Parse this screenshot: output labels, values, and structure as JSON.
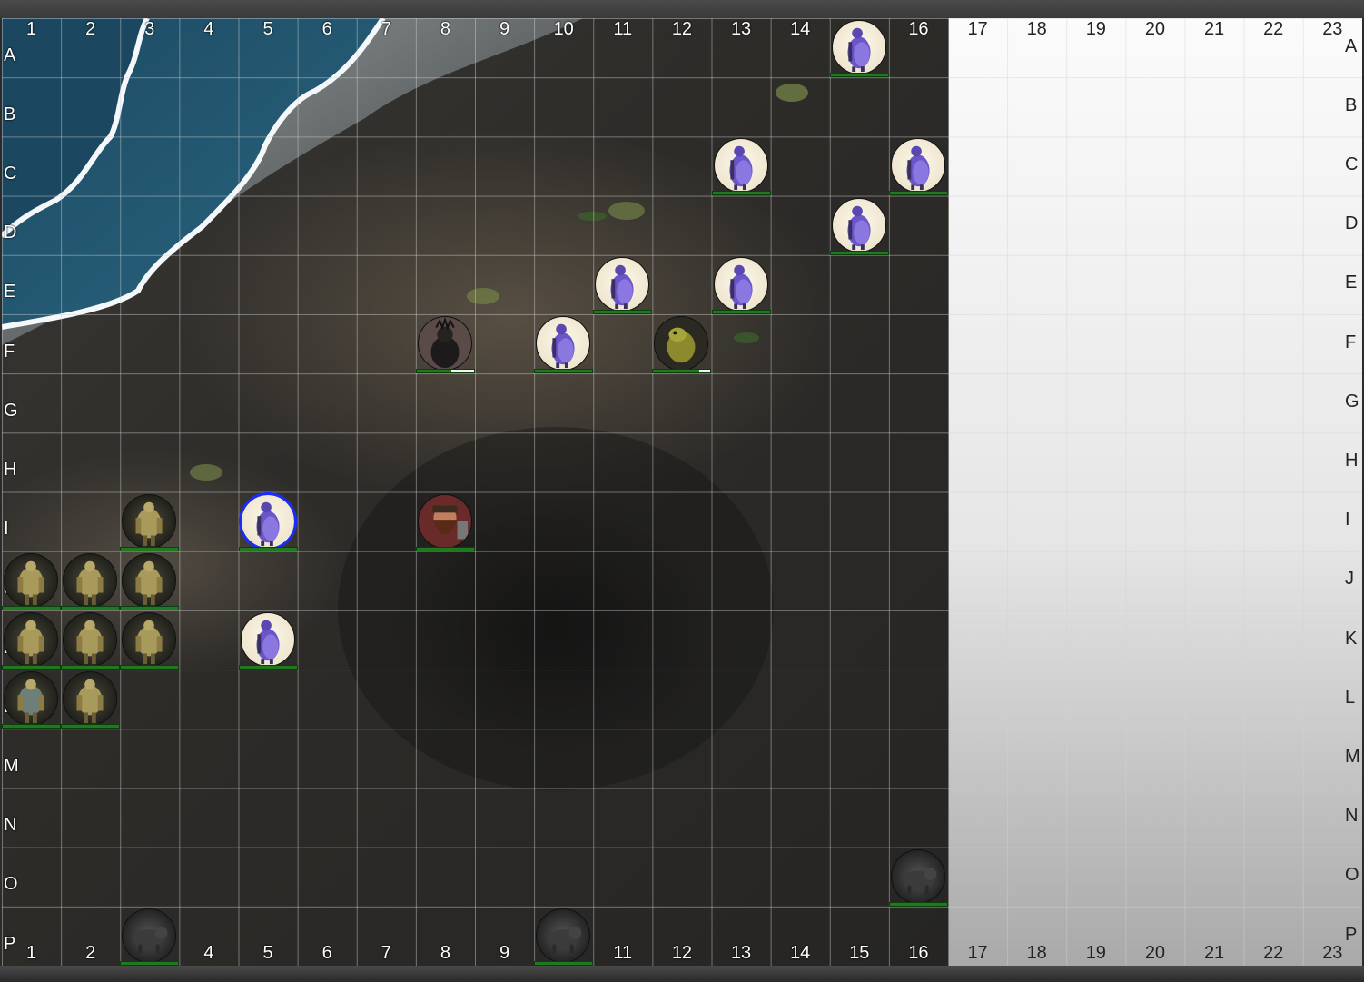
{
  "map": {
    "columns": [
      "1",
      "2",
      "3",
      "4",
      "5",
      "6",
      "7",
      "8",
      "9",
      "10",
      "11",
      "12",
      "13",
      "14",
      "15",
      "16",
      "17",
      "18",
      "19",
      "20",
      "21",
      "22",
      "23"
    ],
    "rows": [
      "A",
      "B",
      "C",
      "D",
      "E",
      "F",
      "G",
      "H",
      "I",
      "J",
      "K",
      "L",
      "M",
      "N",
      "O",
      "P"
    ],
    "last_map_column": "16",
    "colors": {
      "sea": "#1e4d66",
      "foam": "#e8eef2",
      "rock": "#2f2d2a",
      "empty": "#f2f2f2",
      "health_bar": "#1f7a1f",
      "selection": "#1a2bff"
    }
  },
  "tokens": [
    {
      "name": "guard",
      "kind": "hooded-guard",
      "cell": "A15",
      "health": 1.0
    },
    {
      "name": "guard",
      "kind": "hooded-guard",
      "cell": "C13",
      "health": 1.0
    },
    {
      "name": "guard",
      "kind": "hooded-guard",
      "cell": "C16",
      "health": 1.0
    },
    {
      "name": "guard",
      "kind": "hooded-guard",
      "cell": "D15",
      "health": 1.0
    },
    {
      "name": "guard",
      "kind": "hooded-guard",
      "cell": "E11",
      "health": 1.0
    },
    {
      "name": "guard",
      "kind": "hooded-guard",
      "cell": "E13",
      "health": 1.0
    },
    {
      "name": "guard",
      "kind": "hooded-guard",
      "cell": "F10",
      "health": 1.0
    },
    {
      "name": "guard",
      "kind": "hooded-guard",
      "cell": "I5",
      "health": 1.0,
      "selected": true
    },
    {
      "name": "guard",
      "kind": "hooded-guard",
      "cell": "K5",
      "health": 1.0
    },
    {
      "name": "dark-knight",
      "kind": "dark-knight",
      "cell": "F8",
      "health": 0.6
    },
    {
      "name": "lizardfolk",
      "kind": "lizard",
      "cell": "F12",
      "health": 0.8
    },
    {
      "name": "dwarf",
      "kind": "dwarf",
      "cell": "I8",
      "health": 1.0
    },
    {
      "name": "orc",
      "kind": "orc",
      "cell": "I3",
      "health": 1.0
    },
    {
      "name": "orc",
      "kind": "orc",
      "cell": "J1",
      "health": 1.0
    },
    {
      "name": "orc",
      "kind": "orc",
      "cell": "J2",
      "health": 1.0
    },
    {
      "name": "orc",
      "kind": "orc",
      "cell": "J3",
      "health": 1.0
    },
    {
      "name": "orc",
      "kind": "orc",
      "cell": "K1",
      "health": 1.0
    },
    {
      "name": "orc",
      "kind": "orc",
      "cell": "K2",
      "health": 1.0
    },
    {
      "name": "orc",
      "kind": "orc",
      "cell": "K3",
      "health": 1.0
    },
    {
      "name": "orc-chief",
      "kind": "orc-chief",
      "cell": "L1",
      "health": 1.0
    },
    {
      "name": "orc",
      "kind": "orc",
      "cell": "L2",
      "health": 1.0
    },
    {
      "name": "beast",
      "kind": "beast",
      "cell": "O16",
      "health": 1.0
    },
    {
      "name": "beast",
      "kind": "beast",
      "cell": "P3",
      "health": 1.0
    },
    {
      "name": "beast",
      "kind": "beast",
      "cell": "P10",
      "health": 1.0
    }
  ]
}
